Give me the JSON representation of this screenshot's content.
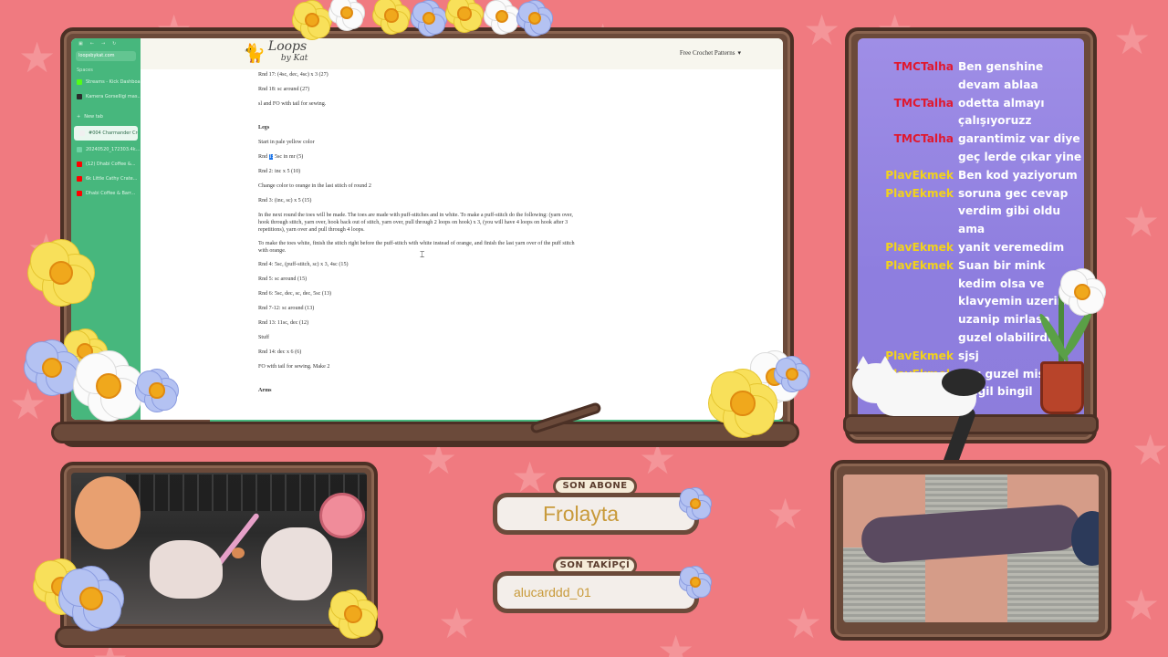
{
  "browser": {
    "sidebar": {
      "url": "loopsbykat.com",
      "spaces_label": "Spaces",
      "pinned": [
        {
          "label": "Streams - Kick Dashboard",
          "icon": "kick-icon",
          "color": "#53fc18"
        },
        {
          "label": "Kamera Gorselligi mas...",
          "icon": "doc-icon",
          "color": "#2b2b2b"
        }
      ],
      "new_tab_label": "New tab",
      "tabs": [
        {
          "label": "#004 Charmander Croch...",
          "icon": "yarn-icon",
          "color": "#f0f0f0",
          "active": true
        },
        {
          "label": "20240520_172303.4k...",
          "icon": "video-icon",
          "color": "#6fd3a4",
          "active": false
        },
        {
          "label": "(12) Dhabi Coffee &...",
          "icon": "youtube-icon",
          "color": "#ff0000",
          "active": false
        },
        {
          "label": "6k Little Cathy Crate...",
          "icon": "youtube-icon",
          "color": "#ff0000",
          "active": false
        },
        {
          "label": "Dhabi Coffee & Barr...",
          "icon": "youtube-icon",
          "color": "#ff0000",
          "active": false
        }
      ]
    },
    "header": {
      "logo_main": "Loops",
      "logo_sub": "by Kat",
      "nav_label": "Free Crochet Patterns",
      "nav_arrow": "▾"
    },
    "article": {
      "lines": [
        {
          "kind": "text",
          "text": "Rnd 17: (4sc, dec, 4sc) x 3 (27)"
        },
        {
          "kind": "text",
          "text": "Rnd 18: sc around (27)"
        },
        {
          "kind": "text",
          "text": "sl and FO with tail for sewing."
        },
        {
          "kind": "head",
          "text": "Legs"
        },
        {
          "kind": "text",
          "text": "Start in pale yellow color"
        },
        {
          "kind": "hl",
          "pre": "Rnd ",
          "hl": "1:",
          "post": " 5sc in mr (5)"
        },
        {
          "kind": "text",
          "text": "Rnd 2: inc x 5 (10)"
        },
        {
          "kind": "text",
          "text": "Change color to orange in the last stitch of round 2"
        },
        {
          "kind": "text",
          "text": "Rnd 3: (inc, sc) x 5 (15)"
        },
        {
          "kind": "par",
          "text": "In the next round the toes will be made. The toes are made with puff-stitches and in white. To make a puff-stitch do the following: (yarn over, hook through stitch, yarn over, hook back out of stitch, yarn over, pull through 2 loops on hook) x 3, (you will have 4 loops on hook after 3 repetitions), yarn over and pull through 4 loops."
        },
        {
          "kind": "par",
          "text": "To make the toes white, finish the stitch right before the puff-stitch with white instead of orange, and finish the last yarn over of the puff stitch with orange."
        },
        {
          "kind": "text",
          "text": "Rnd 4: 5sc, (puff-stitch, sc) x 3, 4sc (15)"
        },
        {
          "kind": "text",
          "text": "Rnd 5: sc around (15)"
        },
        {
          "kind": "text",
          "text": "Rnd 6: 5sc, dec, sc, dec, 5sc (13)"
        },
        {
          "kind": "text",
          "text": "Rnd 7-12: sc around (13)"
        },
        {
          "kind": "text",
          "text": "Rnd 13: 11sc, dec (12)"
        },
        {
          "kind": "text",
          "text": "Stuff"
        },
        {
          "kind": "text",
          "text": "Rnd 14: dec x 6 (6)"
        },
        {
          "kind": "text",
          "text": "FO with tail for sewing. Make 2"
        },
        {
          "kind": "head",
          "text": "Arms"
        }
      ]
    }
  },
  "chat": {
    "messages": [
      {
        "user": "TMCTalha",
        "color": "#e0192f",
        "text": "Ben genshine devam ablaa"
      },
      {
        "user": "TMCTalha",
        "color": "#e0192f",
        "text": "odetta almayı çalışıyoruzz"
      },
      {
        "user": "TMCTalha",
        "color": "#e0192f",
        "text": "garantimiz var diye geç lerde çıkar yine"
      },
      {
        "user": "PlavEkmek",
        "color": "#f2d21c",
        "text": "Ben kod yaziyorum"
      },
      {
        "user": "PlavEkmek",
        "color": "#f2d21c",
        "text": "soruna gec cevap verdim gibi oldu ama"
      },
      {
        "user": "PlavEkmek",
        "color": "#f2d21c",
        "text": "yanit veremedim"
      },
      {
        "user": "PlavEkmek",
        "color": "#f2d21c",
        "text": "Suan bir mink kedim olsa ve klavyemin uzerine uzanip mirlasa guzel olabilirdi."
      },
      {
        "user": "PlavEkmek",
        "color": "#f2d21c",
        "text": "sjsj"
      },
      {
        "user": "PlavEkmek",
        "color": "#f2d21c",
        "text": "4kg guzel mis"
      },
      {
        "user": "PlavEkmek",
        "color": "#f2d21c",
        "text": "bingil bingil"
      }
    ]
  },
  "alerts": {
    "last_sub_label": "SON ABONE",
    "last_sub_name": "Frolayta",
    "last_follow_label": "SON TAKİPÇİ",
    "last_follow_name": "alucarddd_01"
  },
  "colors": {
    "background": "#f07a80",
    "wood": "#6b4a3a",
    "chat_bg": "#9f8ee6",
    "browser_sidebar": "#47b77d"
  }
}
